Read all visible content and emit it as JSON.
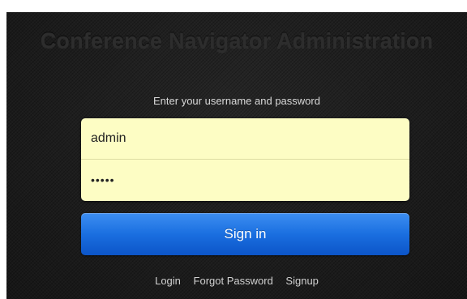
{
  "app": {
    "title": "Conference Navigator Administration"
  },
  "login": {
    "prompt": "Enter your username and password",
    "username_value": "admin",
    "password_value": "•••••",
    "signin_label": "Sign in"
  },
  "links": [
    {
      "label": "Login"
    },
    {
      "label": "Forgot Password"
    },
    {
      "label": "Signup"
    }
  ],
  "colors": {
    "background": "#1d1d1d",
    "field_background": "#fdfdc4",
    "button_blue": "#1a6fe0",
    "title_text": "#2d2d2d",
    "link_text": "#d0d0d0"
  }
}
